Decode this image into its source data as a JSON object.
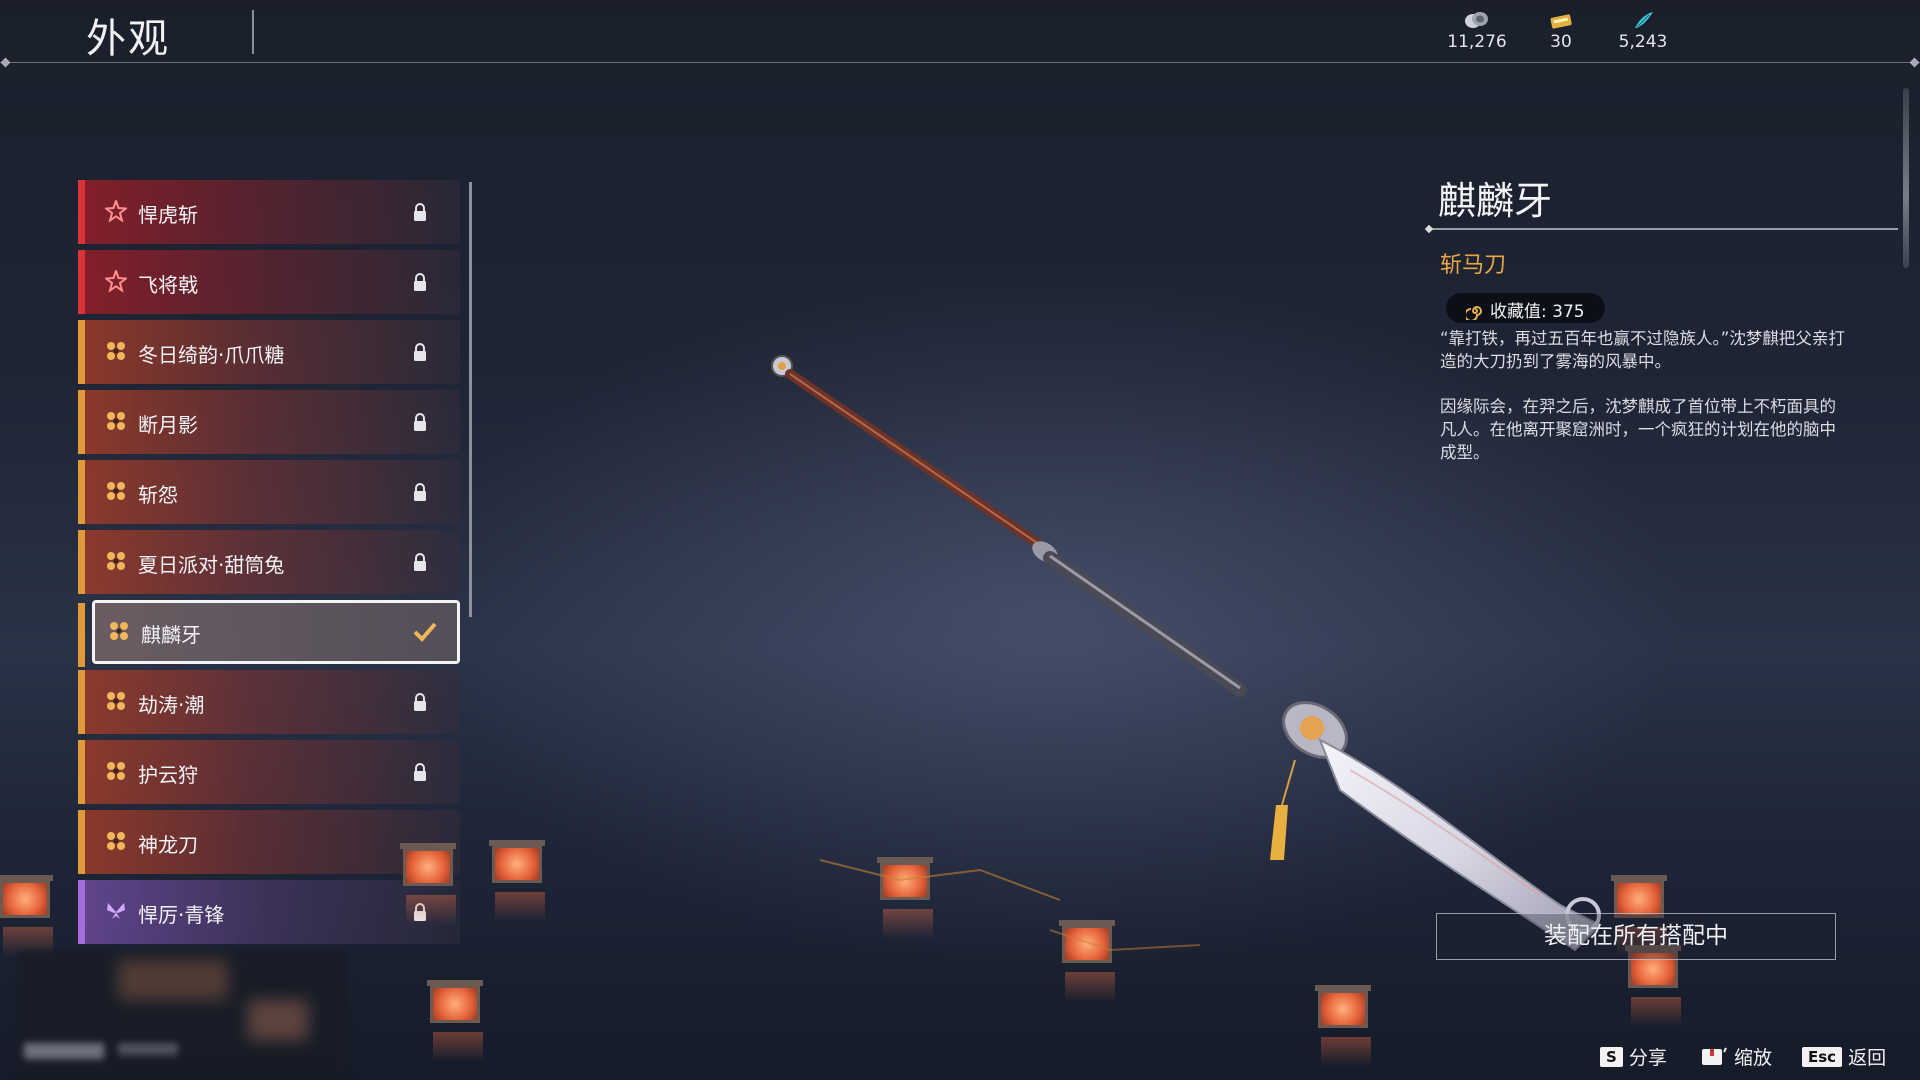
{
  "header": {
    "title": "外观",
    "currencies": [
      {
        "icon": "coin-stack-icon",
        "value": "11,276"
      },
      {
        "icon": "gold-ticket-icon",
        "value": "30"
      },
      {
        "icon": "feather-token-icon",
        "value": "5,243"
      }
    ]
  },
  "list": {
    "items": [
      {
        "label": "悍虎斩",
        "rarity": "red",
        "status": "locked"
      },
      {
        "label": "飞将戟",
        "rarity": "red",
        "status": "locked"
      },
      {
        "label": "冬日绮韵·爪爪糖",
        "rarity": "gold",
        "status": "locked"
      },
      {
        "label": "断月影",
        "rarity": "gold",
        "status": "locked"
      },
      {
        "label": "斩怨",
        "rarity": "gold",
        "status": "locked"
      },
      {
        "label": "夏日派对·甜筒兔",
        "rarity": "gold",
        "status": "locked"
      },
      {
        "label": "麒麟牙",
        "rarity": "gold",
        "status": "equipped"
      },
      {
        "label": "劫涛·潮",
        "rarity": "gold",
        "status": "locked"
      },
      {
        "label": "护云狩",
        "rarity": "gold",
        "status": "locked"
      },
      {
        "label": "神龙刀",
        "rarity": "gold",
        "status": "none"
      },
      {
        "label": "悍厉·青锋",
        "rarity": "purple",
        "status": "locked"
      }
    ]
  },
  "detail": {
    "name": "麒麟牙",
    "type": "斩马刀",
    "collection_label": "收藏值: 375",
    "description": [
      "“靠打铁，再过五百年也赢不过隐族人。”沈梦麒把父亲打造的大刀扔到了雾海的风暴中。",
      "因缘际会，在羿之后，沈梦麒成了首位带上不朽面具的凡人。在他离开聚窟洲时，一个疯狂的计划在他的脑中成型。"
    ],
    "equip_button": "装配在所有搭配中"
  },
  "hints": [
    {
      "key": "S",
      "label": "分享"
    },
    {
      "key": "mouse-icon",
      "label": "缩放"
    },
    {
      "key": "Esc",
      "label": "返回"
    }
  ],
  "colors": {
    "red_rarity": "#d8343a",
    "gold_rarity": "#e19a3a",
    "purple_rarity": "#a76be0",
    "type_text": "#e8a648"
  }
}
